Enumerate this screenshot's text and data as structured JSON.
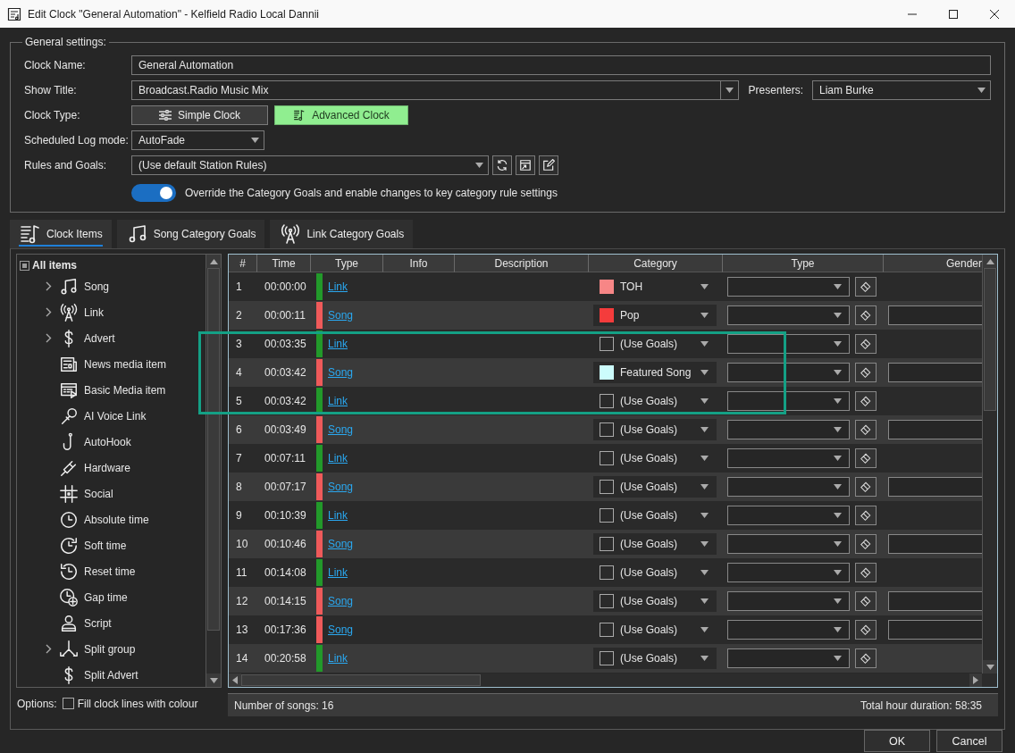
{
  "window": {
    "title": "Edit Clock \"General Automation\" - Kelfield Radio Local Dannii"
  },
  "settings": {
    "legend": "General settings:",
    "clock_name": {
      "label": "Clock Name:",
      "value": "General Automation"
    },
    "show_title": {
      "label": "Show Title:",
      "value": "Broadcast.Radio Music Mix"
    },
    "presenters": {
      "label": "Presenters:",
      "value": "Liam Burke"
    },
    "clock_type": {
      "label": "Clock Type:",
      "options": [
        {
          "label": "Simple Clock",
          "selected": false
        },
        {
          "label": "Advanced Clock",
          "selected": true
        }
      ]
    },
    "log_mode": {
      "label": "Scheduled Log mode:",
      "value": "AutoFade"
    },
    "rules": {
      "label": "Rules and Goals:",
      "value": "(Use default Station Rules)"
    },
    "override": {
      "label": "Override the Category Goals and enable changes to key category rule settings",
      "on": true
    }
  },
  "tabs": [
    {
      "label": "Clock Items",
      "selected": true
    },
    {
      "label": "Song Category Goals",
      "selected": false
    },
    {
      "label": "Link Category Goals",
      "selected": false
    }
  ],
  "tree": {
    "root": {
      "label": "All items",
      "expanded": true
    },
    "items": [
      {
        "label": "Song",
        "kind": "group",
        "expanded": false
      },
      {
        "label": "Link",
        "kind": "group",
        "expanded": false
      },
      {
        "label": "Advert",
        "kind": "group",
        "expanded": false
      },
      {
        "label": "News media item",
        "kind": "leaf"
      },
      {
        "label": "Basic Media item",
        "kind": "leaf"
      },
      {
        "label": "AI Voice Link",
        "kind": "leaf"
      },
      {
        "label": "AutoHook",
        "kind": "leaf"
      },
      {
        "label": "Hardware",
        "kind": "leaf"
      },
      {
        "label": "Social",
        "kind": "leaf"
      },
      {
        "label": "Absolute time",
        "kind": "leaf"
      },
      {
        "label": "Soft time",
        "kind": "leaf"
      },
      {
        "label": "Reset time",
        "kind": "leaf"
      },
      {
        "label": "Gap time",
        "kind": "leaf"
      },
      {
        "label": "Script",
        "kind": "leaf"
      },
      {
        "label": "Split group",
        "kind": "group",
        "expanded": false
      },
      {
        "label": "Split Advert",
        "kind": "leaf"
      }
    ]
  },
  "options": {
    "label": "Options:",
    "fill_colour": {
      "label": "Fill clock lines with colour",
      "checked": false
    }
  },
  "grid": {
    "columns": [
      "#",
      "Time",
      "Type",
      "Info",
      "Description",
      "Category",
      "Type",
      "Gender"
    ],
    "rows": [
      {
        "num": "1",
        "time": "00:00:00",
        "type": "Link",
        "kind": "link",
        "category": "TOH",
        "color": "#f78686",
        "highlighted": false
      },
      {
        "num": "2",
        "time": "00:00:11",
        "type": "Song",
        "kind": "song",
        "category": "Pop",
        "color": "#f43c3c",
        "highlighted": false
      },
      {
        "num": "3",
        "time": "00:03:35",
        "type": "Link",
        "kind": "link",
        "category": "(Use Goals)",
        "highlighted": true
      },
      {
        "num": "4",
        "time": "00:03:42",
        "type": "Song",
        "kind": "song",
        "category": "Featured Song",
        "color": "#ccfcfc",
        "highlighted": true
      },
      {
        "num": "5",
        "time": "00:03:42",
        "type": "Link",
        "kind": "link",
        "category": "(Use Goals)",
        "highlighted": true
      },
      {
        "num": "6",
        "time": "00:03:49",
        "type": "Song",
        "kind": "song",
        "category": "(Use Goals)",
        "highlighted": false
      },
      {
        "num": "7",
        "time": "00:07:11",
        "type": "Link",
        "kind": "link",
        "category": "(Use Goals)",
        "highlighted": false
      },
      {
        "num": "8",
        "time": "00:07:17",
        "type": "Song",
        "kind": "song",
        "category": "(Use Goals)",
        "highlighted": false
      },
      {
        "num": "9",
        "time": "00:10:39",
        "type": "Link",
        "kind": "link",
        "category": "(Use Goals)",
        "highlighted": false
      },
      {
        "num": "10",
        "time": "00:10:46",
        "type": "Song",
        "kind": "song",
        "category": "(Use Goals)",
        "highlighted": false
      },
      {
        "num": "11",
        "time": "00:14:08",
        "type": "Link",
        "kind": "link",
        "category": "(Use Goals)",
        "highlighted": false
      },
      {
        "num": "12",
        "time": "00:14:15",
        "type": "Song",
        "kind": "song",
        "category": "(Use Goals)",
        "highlighted": false
      },
      {
        "num": "13",
        "time": "00:17:36",
        "type": "Song",
        "kind": "song",
        "category": "(Use Goals)",
        "highlighted": false
      },
      {
        "num": "14",
        "time": "00:20:58",
        "type": "Link",
        "kind": "link",
        "category": "(Use Goals)",
        "highlighted": false
      }
    ]
  },
  "status": {
    "songs": "Number of songs: 16",
    "duration": "Total hour duration: 58:35"
  },
  "buttons": [
    "OK",
    "Cancel"
  ]
}
